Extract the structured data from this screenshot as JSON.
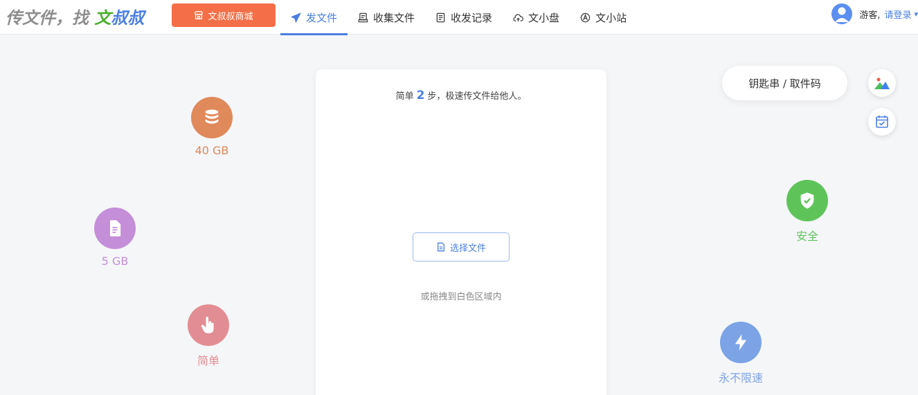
{
  "logo": {
    "part1": "传文件，找 ",
    "part2": "文",
    "part3": "叔叔"
  },
  "shop": {
    "label": "文叔叔商城"
  },
  "nav": {
    "send": "发文件",
    "collect": "收集文件",
    "records": "收发记录",
    "disk": "文小盘",
    "site": "文小站"
  },
  "user": {
    "guest": "游客,",
    "login": "请登录"
  },
  "card": {
    "tip_prefix": "简单",
    "tip_num": "2",
    "tip_suffix": "步，极速传文件给他人。",
    "pick_label": "选择文件",
    "drag_hint": "或拖拽到白色区域内"
  },
  "features": {
    "storage": "40 GB",
    "file_size": "5 GB",
    "simple": "简单",
    "secure": "安全",
    "speed": "永不限速"
  },
  "key_code": {
    "label": "钥匙串 / 取件码"
  },
  "colors": {
    "accent": "#4b7fe0",
    "shop": "#f46f47",
    "storage": "#e0895a",
    "file_size": "#c48ed8",
    "simple": "#e28d93",
    "secure": "#5ec45a",
    "speed": "#7ca3e6"
  }
}
